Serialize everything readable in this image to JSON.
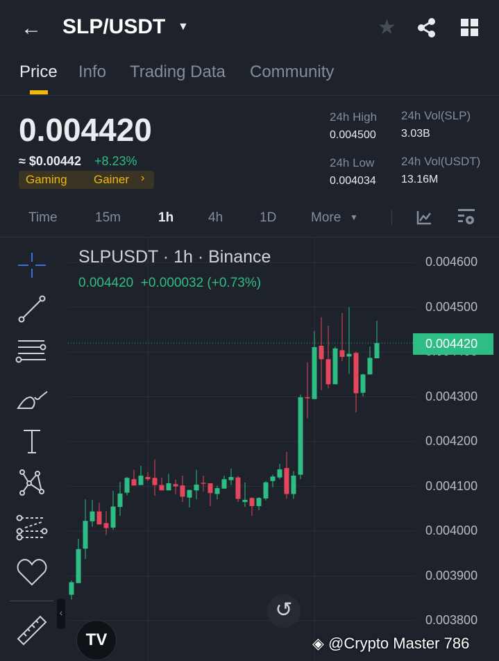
{
  "header": {
    "pair": "SLP/USDT"
  },
  "tabs": [
    "Price",
    "Info",
    "Trading Data",
    "Community"
  ],
  "ticker": {
    "last_price": "0.004420",
    "usd_price": "≈ $0.00442",
    "change": "+8.23%",
    "tag1": "Gaming",
    "tag2": "Gainer",
    "high_label": "24h High",
    "high": "0.004500",
    "low_label": "24h Low",
    "low": "0.004034",
    "vol_slp_label": "24h Vol(SLP)",
    "vol_slp": "3.03B",
    "vol_usdt_label": "24h Vol(USDT)",
    "vol_usdt": "13.16M"
  },
  "timeframes": [
    "Time",
    "15m",
    "1h",
    "4h",
    "1D",
    "More"
  ],
  "chart_legend": {
    "title": "SLPUSDT · 1h · Binance",
    "values": "0.004420  +0.000032 (+0.73%)"
  },
  "watermark": "@Crypto Master 786",
  "colors": {
    "up": "#2ebd85",
    "down": "#e4475d",
    "accent": "#f0b90b",
    "bg": "#1e222b"
  },
  "chart_data": {
    "type": "candlestick",
    "symbol": "SLPUSDT",
    "interval": "1h",
    "ylim": [
      0.00375,
      0.00465
    ],
    "yticks": [
      "0.004600",
      "0.004500",
      "0.004400",
      "0.004300",
      "0.004200",
      "0.004100",
      "0.004000",
      "0.003900",
      "0.003800"
    ],
    "ytick_values": [
      0.0046,
      0.0045,
      0.0044,
      0.0043,
      0.0042,
      0.0041,
      0.004,
      0.0039,
      0.0038
    ],
    "last_price_label": "0.004420",
    "last_price": 0.00442,
    "ohlc": [
      [
        0.003858,
        0.00389,
        0.003847,
        0.003886
      ],
      [
        0.003884,
        0.003983,
        0.003884,
        0.00396
      ],
      [
        0.003961,
        0.004071,
        0.003938,
        0.004023
      ],
      [
        0.004022,
        0.00407,
        0.00401,
        0.004044
      ],
      [
        0.004044,
        0.004064,
        0.004015,
        0.004015
      ],
      [
        0.004018,
        0.004045,
        0.003991,
        0.004007
      ],
      [
        0.004008,
        0.00409,
        0.004003,
        0.004055
      ],
      [
        0.004054,
        0.00411,
        0.004034,
        0.004084
      ],
      [
        0.004086,
        0.004121,
        0.00408,
        0.004119
      ],
      [
        0.004116,
        0.004137,
        0.004102,
        0.004102
      ],
      [
        0.004103,
        0.004146,
        0.004103,
        0.004124
      ],
      [
        0.004121,
        0.004132,
        0.004112,
        0.004116
      ],
      [
        0.004119,
        0.00416,
        0.004079,
        0.004103
      ],
      [
        0.004103,
        0.004119,
        0.004091,
        0.004091
      ],
      [
        0.004091,
        0.004128,
        0.004091,
        0.004107
      ],
      [
        0.004105,
        0.004115,
        0.004083,
        0.0041
      ],
      [
        0.004102,
        0.004124,
        0.004065,
        0.004077
      ],
      [
        0.004075,
        0.004092,
        0.004053,
        0.004092
      ],
      [
        0.004091,
        0.004137,
        0.004071,
        0.004104
      ],
      [
        0.004108,
        0.004124,
        0.004089,
        0.004106
      ],
      [
        0.004107,
        0.004107,
        0.004056,
        0.004085
      ],
      [
        0.004083,
        0.004102,
        0.004071,
        0.004096
      ],
      [
        0.004095,
        0.004124,
        0.004095,
        0.004116
      ],
      [
        0.004114,
        0.00414,
        0.004103,
        0.004121
      ],
      [
        0.00412,
        0.004123,
        0.004065,
        0.004072
      ],
      [
        0.004065,
        0.004109,
        0.004054,
        0.00407
      ],
      [
        0.004074,
        0.004076,
        0.004034,
        0.004056
      ],
      [
        0.004056,
        0.004076,
        0.004047,
        0.004074
      ],
      [
        0.004073,
        0.004112,
        0.004069,
        0.004109
      ],
      [
        0.004112,
        0.004126,
        0.004098,
        0.004122
      ],
      [
        0.00412,
        0.00415,
        0.004116,
        0.004138
      ],
      [
        0.004141,
        0.004177,
        0.004072,
        0.004083
      ],
      [
        0.004083,
        0.004134,
        0.004072,
        0.004124
      ],
      [
        0.004126,
        0.004305,
        0.004116,
        0.004299
      ],
      [
        0.004299,
        0.004377,
        0.004252,
        0.004297
      ],
      [
        0.004295,
        0.004447,
        0.004295,
        0.004411
      ],
      [
        0.004414,
        0.004478,
        0.004315,
        0.004384
      ],
      [
        0.004384,
        0.004459,
        0.004319,
        0.004328
      ],
      [
        0.004328,
        0.004412,
        0.004328,
        0.004408
      ],
      [
        0.004404,
        0.004487,
        0.00438,
        0.004389
      ],
      [
        0.00439,
        0.0045,
        0.004351,
        0.004396
      ],
      [
        0.004398,
        0.004401,
        0.004265,
        0.004308
      ],
      [
        0.004309,
        0.004351,
        0.004301,
        0.00435
      ],
      [
        0.00435,
        0.004412,
        0.00435,
        0.004387
      ],
      [
        0.004386,
        0.00447,
        0.004386,
        0.00442
      ]
    ]
  }
}
